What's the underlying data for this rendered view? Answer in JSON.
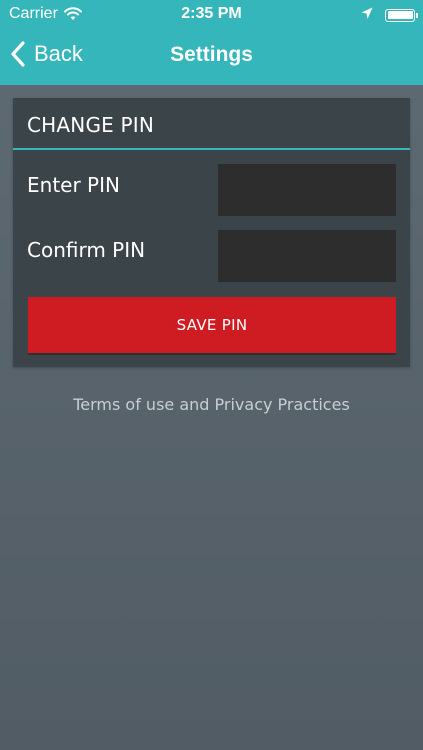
{
  "status_bar": {
    "carrier": "Carrier",
    "time": "2:35 PM",
    "icons": [
      "wifi-icon",
      "location-arrow-icon",
      "battery-icon"
    ]
  },
  "nav": {
    "back_label": "Back",
    "title": "Settings",
    "back_icon": "chevron-left-icon"
  },
  "change_pin": {
    "title": "CHANGE PIN",
    "enter_label": "Enter PIN",
    "confirm_label": "Confirm PIN",
    "enter_value": "",
    "confirm_value": "",
    "save_label": "SAVE PIN"
  },
  "footer": {
    "terms_link": "Terms of use and Privacy Practices"
  },
  "colors": {
    "header": "#35b6ba",
    "accent": "#38b6bb",
    "panel": "#3b4449",
    "input": "#2d2d2e",
    "save_button": "#cf1c22",
    "background": "#586369"
  }
}
